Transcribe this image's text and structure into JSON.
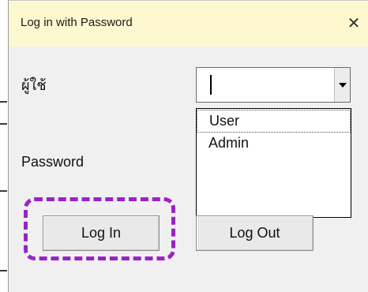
{
  "window": {
    "title": "Log in with Password",
    "close_glyph": "✕"
  },
  "form": {
    "user_label": "ผู้ใช้",
    "password_label": "Password",
    "user_combo": {
      "value": "",
      "options": [
        "User",
        "Admin"
      ]
    }
  },
  "buttons": {
    "login_label": "Log In",
    "logout_label": "Log Out"
  },
  "annotation": {
    "highlight_color": "#9a22c7",
    "highlight_target": "login-button"
  }
}
